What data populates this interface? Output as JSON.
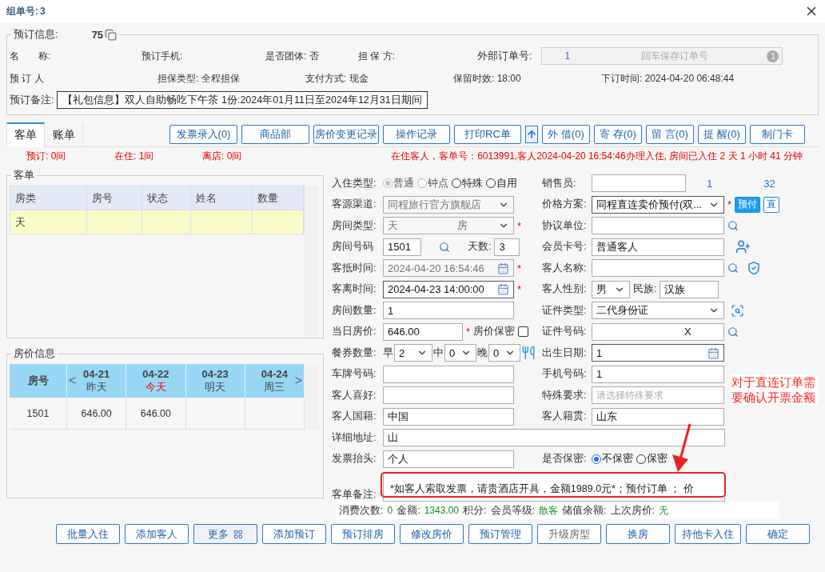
{
  "window": {
    "title_label": "组单号:",
    "title_value": "3"
  },
  "booking": {
    "legend": "预订信息:",
    "order_no": "75",
    "row1": [
      {
        "label": "名　　称:"
      },
      {
        "label": "预订手机:"
      },
      {
        "label": "是否团体:",
        "value": "否"
      },
      {
        "label": "担 保 方:"
      }
    ],
    "external": {
      "label": "外部订单号:",
      "value": "1",
      "placeholder": "回车保存订单号",
      "badge": "1"
    },
    "row2": [
      {
        "label": "预 订 人"
      },
      {
        "label": "担保类型:",
        "value": "全程担保"
      },
      {
        "label": "支付方式:",
        "value": "现金"
      },
      {
        "label": "保留时效:",
        "value": "18:00"
      },
      {
        "label": "下订时间:",
        "value": "2024-04-20 06:48:44"
      }
    ],
    "remark": {
      "label": "预订备注:",
      "value": "【礼包信息】双人自助畅吃下午茶 1份:2024年01月11日至2024年12月31日期间"
    }
  },
  "tabs": [
    {
      "label": "客单",
      "selected": true
    },
    {
      "label": "账单",
      "selected": false
    }
  ],
  "toolbar": [
    {
      "label": "发票录入(0)"
    },
    {
      "label": "商品部"
    },
    {
      "label": "房价变更记录"
    },
    {
      "label": "操作记录"
    },
    {
      "label": "打印RC单"
    }
  ],
  "toolbar2": [
    {
      "label": "外 借(0)"
    },
    {
      "label": "寄 存(0)"
    },
    {
      "label": "留 言(0)"
    },
    {
      "label": "提 醒(0)"
    },
    {
      "label": "制门卡"
    }
  ],
  "counts": [
    {
      "label": "预订:",
      "value": "0间"
    },
    {
      "label": "在住:",
      "value": "1间"
    },
    {
      "label": "离店:",
      "value": "0间"
    }
  ],
  "status_message": "在住客人，客单号：6013991,客人2024-04-20 16:54:46办理入住, 房间已入住 2 天 1 小时 41 分钟",
  "guest_list": {
    "legend": "客单",
    "columns": [
      "房类",
      "房号",
      "状态",
      "姓名",
      "数量"
    ],
    "rows": [
      {
        "selected": true,
        "cells": [
          "天"
        ]
      }
    ]
  },
  "rates": {
    "legend": "房价信息",
    "room_header": "房号",
    "prev": "<",
    "next": ">",
    "days": [
      {
        "date": "04-21",
        "day": "昨天",
        "today": false
      },
      {
        "date": "04-22",
        "day": "今天",
        "today": true
      },
      {
        "date": "04-23",
        "day": "明天",
        "today": false
      },
      {
        "date": "04-24",
        "day": "周三",
        "today": false
      }
    ],
    "rows": [
      {
        "room": "1501",
        "prices": [
          "646.00",
          "646.00"
        ]
      }
    ]
  },
  "form": {
    "checkin_type": {
      "label": "入住类型:",
      "options": [
        {
          "text": "普通",
          "selected": true,
          "disabled": true
        },
        {
          "text": "钟点",
          "selected": false,
          "disabled": true
        },
        {
          "text": "特殊",
          "selected": false,
          "disabled": false
        },
        {
          "text": "自用",
          "selected": false,
          "disabled": false
        }
      ]
    },
    "salesperson": {
      "label": "销售员:"
    },
    "link_texts": [
      "1",
      "32"
    ],
    "source": {
      "label": "客源渠道:",
      "value": "同程旅行官方旗舰店",
      "disabled": true
    },
    "rate_plan": {
      "label": "价格方案:",
      "value": "同程直连卖价预付(双...",
      "required_mark": "*",
      "tags": [
        {
          "text": "预付",
          "filled": true
        },
        {
          "text": "直",
          "filled": false
        }
      ]
    },
    "room_type": {
      "label": "房间类型:",
      "value": "天",
      "value_end": "房",
      "disabled": true,
      "required_mark": "*"
    },
    "company": {
      "label": "协议单位:"
    },
    "room_no": {
      "label": "房间号码",
      "value": "1501"
    },
    "days": {
      "label": "天数:",
      "value": "3"
    },
    "member_card": {
      "label": "会员卡号:",
      "value": "普通客人"
    },
    "arrival": {
      "label": "客抵时间:",
      "value": "2024-04-20 16:54:46",
      "disabled": true,
      "required_mark": "*"
    },
    "guest_name": {
      "label": "客人名称:"
    },
    "departure": {
      "label": "客离时间:",
      "value": "2024-04-23 14:00:00",
      "disabled": false,
      "required_mark": "*"
    },
    "gender": {
      "label": "客人性别:",
      "value": "男"
    },
    "ethnicity": {
      "label": "民族:",
      "value": "汉族"
    },
    "room_count": {
      "label": "房间数量:",
      "value": "1"
    },
    "id_type": {
      "label": "证件类型:",
      "value": "二代身份证"
    },
    "daily_rate": {
      "label": "当日房价:",
      "value": "646.00",
      "required_mark": "*"
    },
    "rate_secret": {
      "label": "房价保密",
      "checked": false
    },
    "id_no": {
      "label": "证件号码:",
      "value": "X"
    },
    "meal": {
      "label": "餐券数量:",
      "items": [
        {
          "label": "早",
          "value": "2"
        },
        {
          "label": "中",
          "value": "0"
        },
        {
          "label": "晚",
          "value": "0"
        }
      ]
    },
    "birth": {
      "label": "出生日期:",
      "value": "1"
    },
    "plate": {
      "label": "车牌号码:"
    },
    "mobile": {
      "label": "手机号码:",
      "value": "1"
    },
    "preference": {
      "label": "客人喜好:"
    },
    "special": {
      "label": "特殊要求:",
      "placeholder": "请选择特殊要求"
    },
    "nationality": {
      "label": "客人国籍:",
      "value": "中国"
    },
    "native": {
      "label": "客人籍贯:",
      "value": "山东"
    },
    "address": {
      "label": "详细地址:",
      "value": "山"
    },
    "invoice_title": {
      "label": "发票抬头:",
      "value": "个人"
    },
    "privacy": {
      "label": "是否保密:",
      "options": [
        {
          "text": "不保密",
          "selected": true
        },
        {
          "text": "保密",
          "selected": false
        }
      ]
    },
    "remark": {
      "label": "客单备注:",
      "value": "*如客人索取发票，请贵酒店开具，金额1989.0元*；预付订单 ； 价"
    }
  },
  "stats": [
    {
      "label": "消费次数:",
      "value": "0"
    },
    {
      "label": "金额:",
      "value": "1343.00"
    },
    {
      "label": "积分:"
    },
    {
      "label": "会员等级:",
      "value": "散客"
    },
    {
      "label": "储值余额:"
    },
    {
      "label": "上次房价:",
      "value": "无"
    }
  ],
  "annotation": {
    "text": "对于直连订单需要确认开票金额"
  },
  "actions": [
    {
      "label": "批量入住",
      "kind": "normal",
      "disabled": false
    },
    {
      "label": "添加客人",
      "kind": "normal",
      "disabled": false
    },
    {
      "label": "更多",
      "kind": "more",
      "disabled": false
    },
    {
      "label": "添加预订",
      "kind": "normal",
      "disabled": false
    },
    {
      "label": "预订排房",
      "kind": "normal",
      "disabled": false
    },
    {
      "label": "修改房价",
      "kind": "normal",
      "disabled": false
    },
    {
      "label": "预订管理",
      "kind": "normal",
      "disabled": false
    },
    {
      "label": "升级房型",
      "kind": "normal",
      "disabled": true
    },
    {
      "label": "换房",
      "kind": "normal",
      "disabled": false
    },
    {
      "label": "持他卡入住",
      "kind": "normal",
      "disabled": false
    },
    {
      "label": "确定",
      "kind": "normal",
      "disabled": false
    }
  ]
}
